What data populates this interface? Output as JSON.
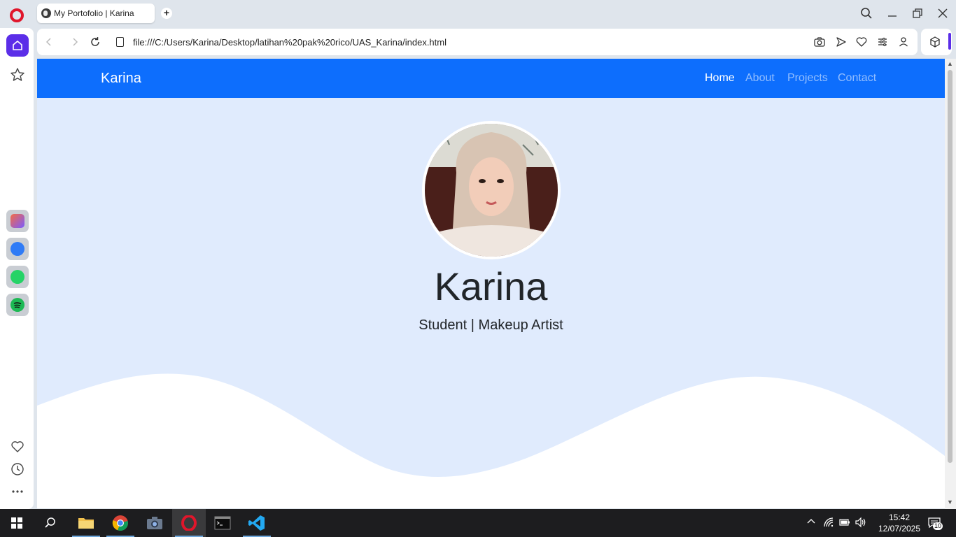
{
  "browser": {
    "tab_title": "My Portofolio | Karina",
    "new_tab_label": "+",
    "url": "file:///C:/Users/Karina/Desktop/latihan%20pak%20rico/UAS_Karina/index.html",
    "accent": "#5b2ee8"
  },
  "sidebar": {
    "apps": [
      {
        "name": "aria-icon",
        "color": "#e85d3a"
      },
      {
        "name": "messenger-icon",
        "color": "#2f7bf6"
      },
      {
        "name": "whatsapp-icon",
        "color": "#25d366"
      },
      {
        "name": "spotify-icon",
        "color": "#1db954"
      }
    ]
  },
  "page": {
    "brand": "Karina",
    "nav": [
      {
        "label": "Home",
        "active": true
      },
      {
        "label": "About",
        "active": false
      },
      {
        "label": "Projects",
        "active": false
      },
      {
        "label": "Contact",
        "active": false
      }
    ],
    "hero": {
      "name": "Karina",
      "subtitle": "Student | Makeup Artist"
    },
    "colors": {
      "navbar": "#0d6efd",
      "hero_bg": "#e0ebfd"
    }
  },
  "taskbar": {
    "time": "15:42",
    "date": "12/07/2025",
    "notifications": "10",
    "apps": [
      "start-icon",
      "search-icon",
      "file-explorer-icon",
      "chrome-icon",
      "camera-icon",
      "opera-icon",
      "terminal-icon",
      "vscode-icon"
    ]
  }
}
